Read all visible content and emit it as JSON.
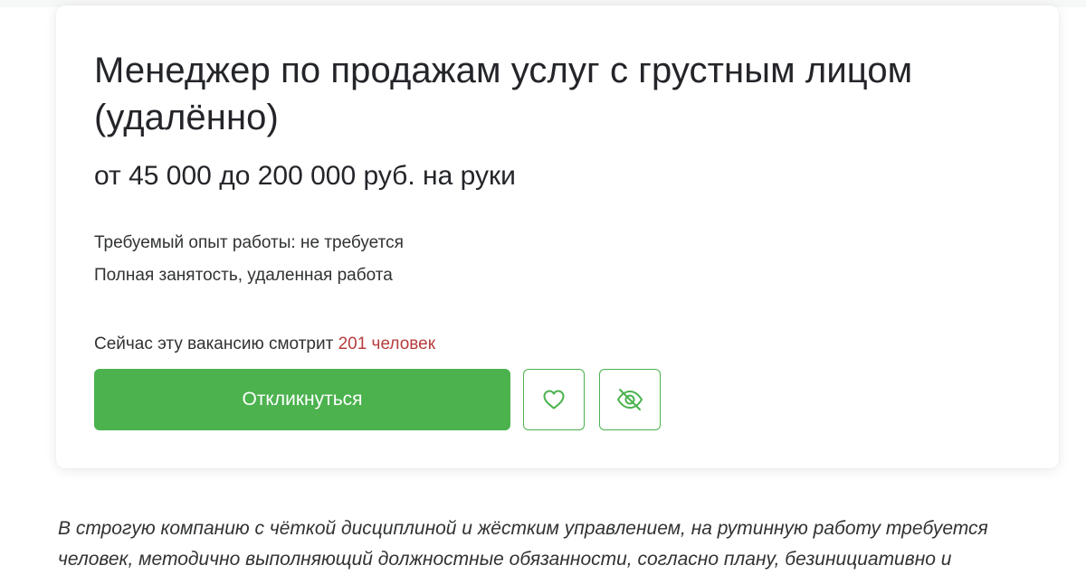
{
  "vacancy": {
    "title": "Менеджер по продажам услуг с грустным лицом (удалённо)",
    "salary": "от 45 000 до 200 000 руб. на руки",
    "experience": "Требуемый опыт работы: не требуется",
    "employment": "Полная занятость, удаленная работа",
    "viewers_prefix": "Сейчас эту вакансию смотрит ",
    "viewers_count": "201 человек",
    "apply_label": "Откликнуться"
  },
  "actions": {
    "favorite_icon": "heart-icon",
    "hide_icon": "eye-off-icon"
  },
  "description": {
    "line1": "В строгую компанию с чёткой дисциплиной и жёстким управлением, на рутинную работу требуется",
    "line2": "человек, методично выполняющий должностные обязанности, согласно плану, безинициативно и"
  },
  "colors": {
    "accent": "#4bb24e",
    "viewers_highlight": "#b73d3d",
    "text": "#303233"
  }
}
